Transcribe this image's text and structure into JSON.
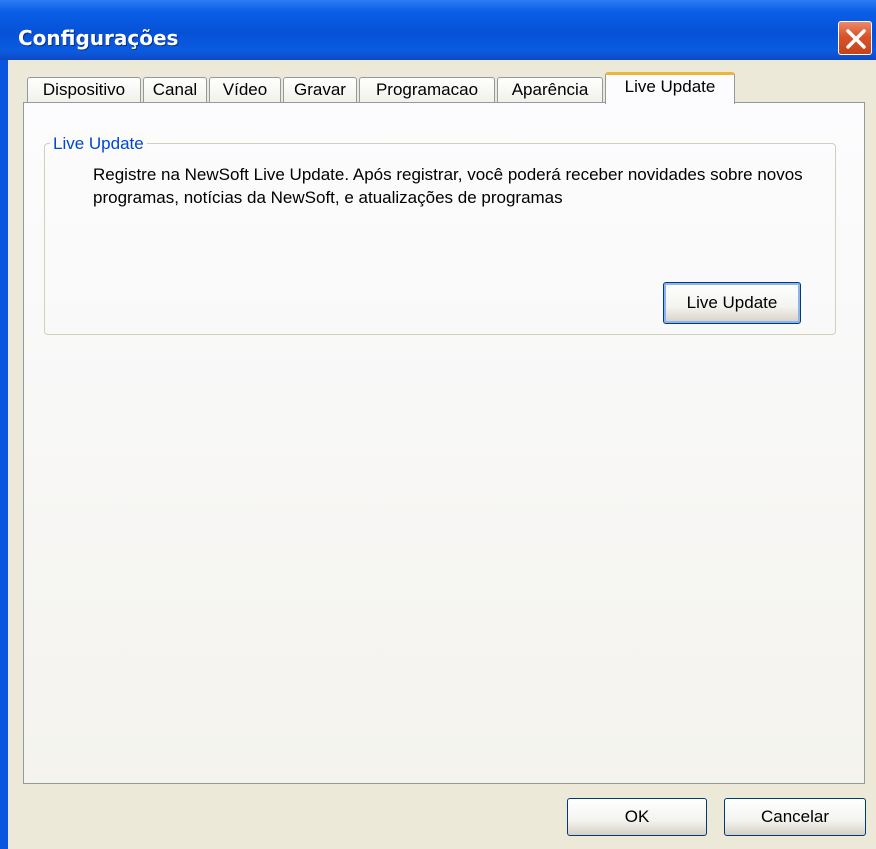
{
  "window": {
    "title": "Configurações"
  },
  "tabs": [
    {
      "label": "Dispositivo",
      "active": false
    },
    {
      "label": "Canal",
      "active": false
    },
    {
      "label": "Vídeo",
      "active": false
    },
    {
      "label": "Gravar",
      "active": false
    },
    {
      "label": "Programacao",
      "active": false
    },
    {
      "label": "Aparência",
      "active": false
    },
    {
      "label": "Live Update",
      "active": true
    }
  ],
  "live_update": {
    "group_title": "Live Update",
    "description": "Registre na NewSoft Live Update. Após registrar, você poderá receber novidades sobre novos programas, notícias da NewSoft, e atualizações de programas",
    "button_label": "Live Update"
  },
  "footer": {
    "ok_label": "OK",
    "cancel_label": "Cancelar"
  },
  "icons": {
    "close": "close-icon"
  },
  "colors": {
    "titlebar": "#0552d8",
    "close_button": "#d9532a",
    "active_tab_accent": "#f0b438",
    "group_title": "#0046d5",
    "dialog_background": "#ece9d8"
  }
}
